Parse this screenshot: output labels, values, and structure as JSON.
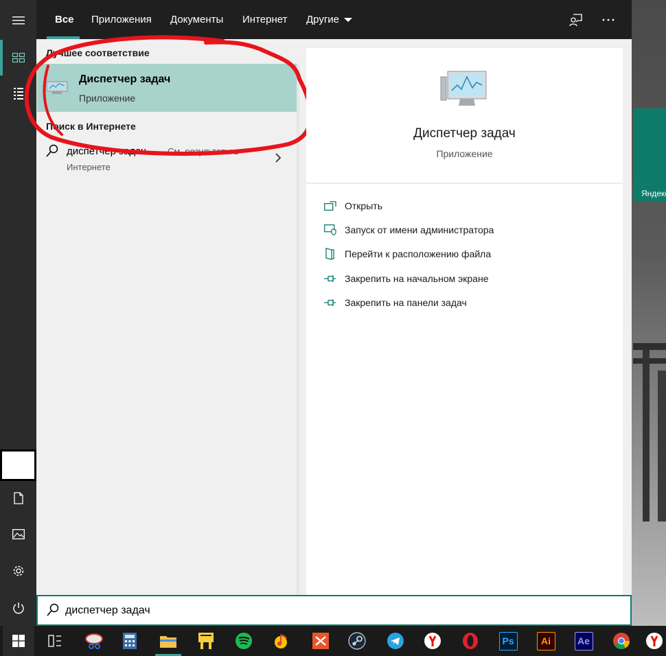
{
  "desktop": {
    "tile_label": "Яндекс"
  },
  "rail": {
    "items": [
      {
        "icon": "hamburger-icon"
      },
      {
        "icon": "home-grid-icon"
      },
      {
        "icon": "list-icon"
      },
      {
        "icon": "user-avatar"
      },
      {
        "icon": "document-icon"
      },
      {
        "icon": "pictures-icon"
      },
      {
        "icon": "gear-icon"
      },
      {
        "icon": "power-icon"
      }
    ]
  },
  "tabs": {
    "all": "Все",
    "apps": "Приложения",
    "documents": "Документы",
    "internet": "Интернет",
    "other": "Другие"
  },
  "topbar_icons": [
    "feedback-icon",
    "more-icon"
  ],
  "list": {
    "best_match_title": "Лучшее соответствие",
    "best_match": {
      "name": "Диспетчер задач",
      "type": "Приложение"
    },
    "web_title": "Поиск в Интернете",
    "web_item": {
      "query": "диспетчер задач",
      "hint": "- См. результаты в",
      "hint2": "Интернете"
    }
  },
  "details": {
    "name": "Диспетчер задач",
    "type": "Приложение",
    "actions": [
      {
        "label": "Открыть",
        "icon": "open-icon"
      },
      {
        "label": "Запуск от имени администратора",
        "icon": "shield-icon"
      },
      {
        "label": "Перейти к расположению файла",
        "icon": "file-location-icon"
      },
      {
        "label": "Закрепить на начальном экране",
        "icon": "pin-icon"
      },
      {
        "label": "Закрепить на панели задач",
        "icon": "pin-icon"
      }
    ]
  },
  "search": {
    "value": "диспетчер задач"
  },
  "taskbar": {
    "apps": [
      "windows-start",
      "task-view",
      "snipping-tool",
      "calculator",
      "file-explorer",
      "sticky-notes",
      "spotify",
      "yandex-music",
      "vpn-app",
      "steam",
      "telegram",
      "yandex-browser",
      "opera",
      "photoshop",
      "illustrator",
      "after-effects",
      "chrome",
      "yandex-browser-2"
    ],
    "ps": "Ps",
    "ai": "Ai",
    "ae": "Ae"
  },
  "colors": {
    "accent": "#39a29a",
    "selection": "#a7d3cc",
    "search_border": "#0f7a6c",
    "annotation": "#e8141b"
  }
}
